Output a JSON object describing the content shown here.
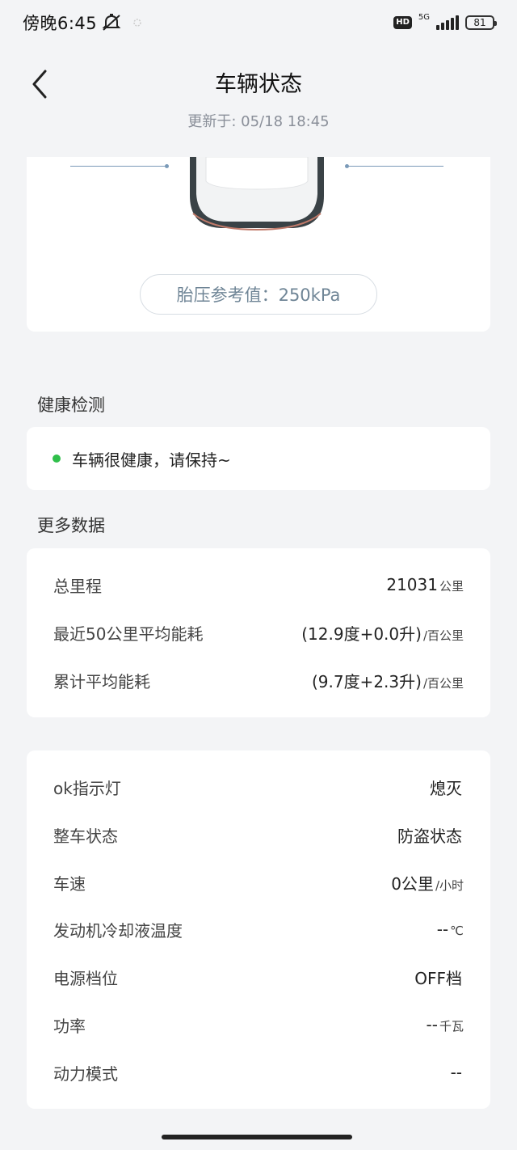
{
  "status_bar": {
    "time": "傍晚6:45",
    "network": "5G",
    "hd": "HD",
    "battery": "81"
  },
  "header": {
    "title": "车辆状态",
    "update_time": "更新于: 05/18 18:45"
  },
  "tire": {
    "reference": "胎压参考值：250kPa"
  },
  "health": {
    "section_title": "健康检测",
    "status_text": "车辆很健康，请保持~",
    "status_color": "#2fbf4a"
  },
  "more_data": {
    "section_title": "更多数据",
    "rows": [
      {
        "label": "总里程",
        "value": "21031",
        "unit": "公里"
      },
      {
        "label": "最近50公里平均能耗",
        "value": "(12.9度+0.0升)",
        "unit": "/百公里"
      },
      {
        "label": "累计平均能耗",
        "value": "(9.7度+2.3升)",
        "unit": "/百公里"
      }
    ]
  },
  "status_data": {
    "rows": [
      {
        "label": "ok指示灯",
        "value": "熄灭",
        "unit": ""
      },
      {
        "label": "整车状态",
        "value": "防盗状态",
        "unit": ""
      },
      {
        "label": "车速",
        "value": "0公里",
        "unit": "/小时"
      },
      {
        "label": "发动机冷却液温度",
        "value": "--",
        "unit": "℃"
      },
      {
        "label": "电源档位",
        "value": "OFF档",
        "unit": ""
      },
      {
        "label": "功率",
        "value": "--",
        "unit": "千瓦"
      },
      {
        "label": "动力模式",
        "value": "--",
        "unit": ""
      }
    ]
  }
}
